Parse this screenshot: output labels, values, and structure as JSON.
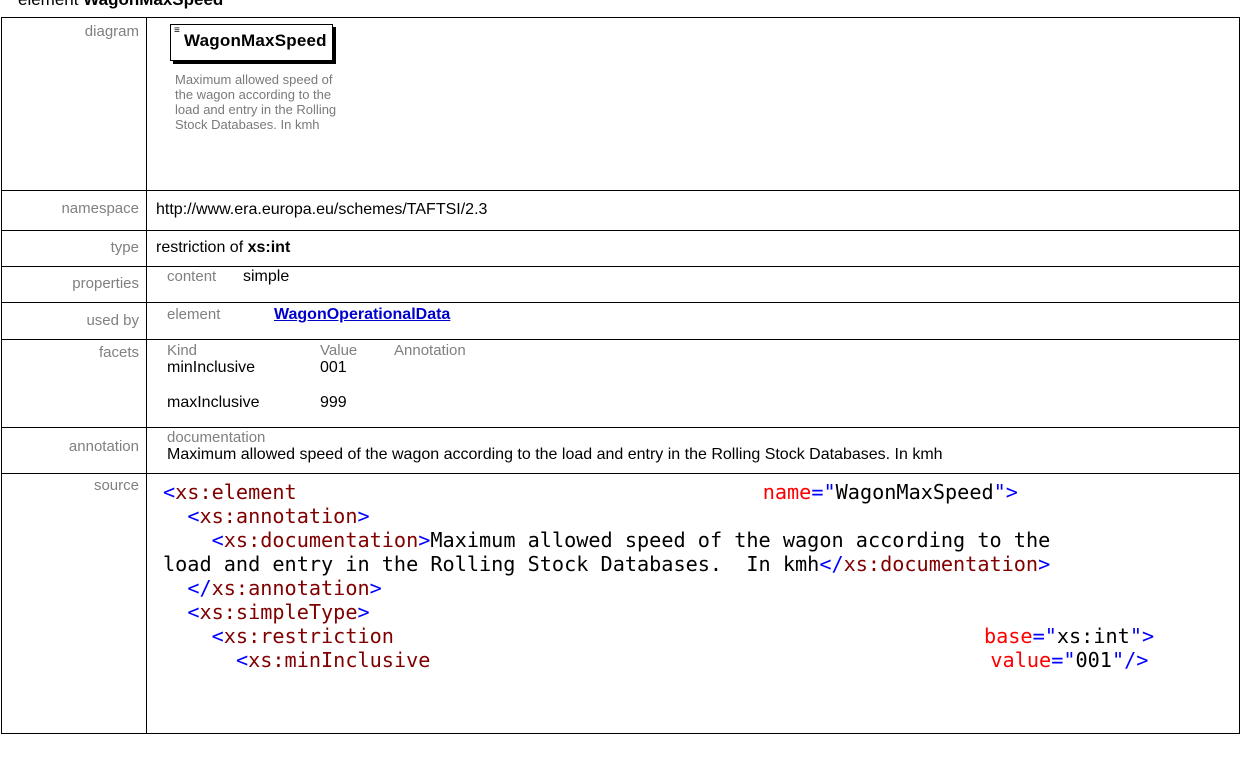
{
  "heading": {
    "prefix": "element ",
    "name": "WagonMaxSpeed"
  },
  "rows": {
    "diagram": {
      "label": "diagram",
      "element_name": "WagonMaxSpeed",
      "doc_lines": [
        "Maximum allowed speed of",
        "the wagon according to the",
        "load and entry in the Rolling",
        "Stock Databases.  In kmh"
      ]
    },
    "namespace": {
      "label": "namespace",
      "value": "http://www.era.europa.eu/schemes/TAFTSI/2.3"
    },
    "type": {
      "label": "type",
      "prefix": "restriction of ",
      "base": "xs:int"
    },
    "properties": {
      "label": "properties",
      "key": "content",
      "value": "simple"
    },
    "used_by": {
      "label": "used by",
      "key": "element",
      "link": "WagonOperationalData"
    },
    "facets": {
      "label": "facets",
      "headers": [
        "Kind",
        "Value",
        "Annotation"
      ],
      "items": [
        {
          "kind": "minInclusive",
          "value": "001"
        },
        {
          "kind": "maxInclusive",
          "value": "999"
        }
      ]
    },
    "annotation": {
      "label": "annotation",
      "key": "documentation",
      "value": "Maximum allowed speed of the wagon according to the load and entry in the Rolling Stock Databases.  In kmh"
    },
    "source": {
      "label": "source",
      "element_tag": "xs:element",
      "name_attr": "name",
      "name_value": "WagonMaxSpeed",
      "annotation_tag": "xs:annotation",
      "documentation_tag": "xs:documentation",
      "doc_text_1": "Maximum allowed speed of the wagon according to the",
      "doc_text_2": "load and entry in the Rolling Stock Databases.  In kmh",
      "simpletype_tag": "xs:simpleType",
      "restriction_tag": "xs:restriction",
      "base_attr": "base",
      "base_value": "xs:int",
      "mininclusive_tag": "xs:minInclusive",
      "value_attr": "value",
      "value_value": "001"
    }
  }
}
